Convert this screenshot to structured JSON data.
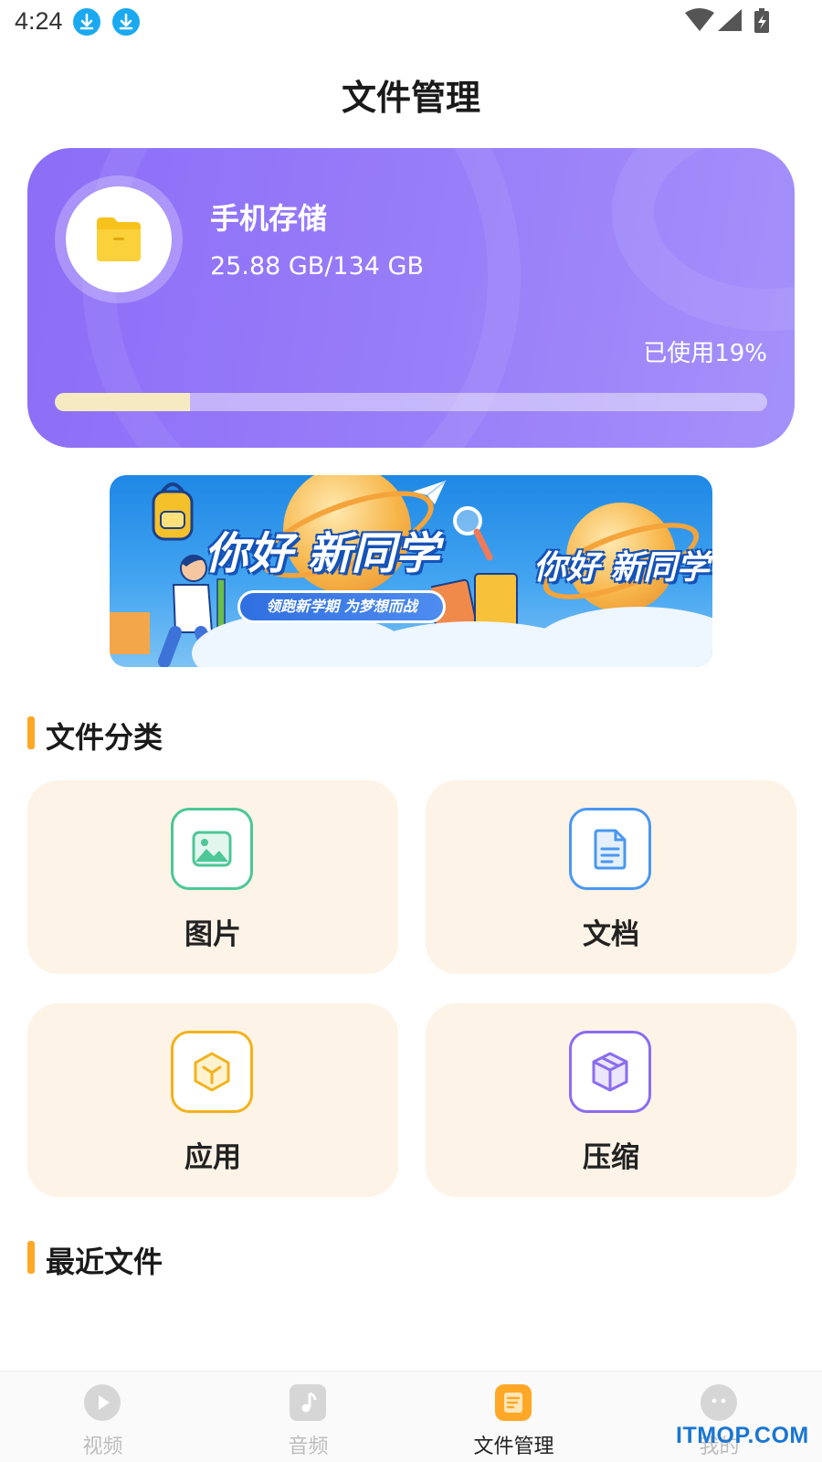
{
  "status_bar": {
    "time": "4:24"
  },
  "header": {
    "title": "文件管理"
  },
  "storage": {
    "name": "手机存储",
    "size_text": "25.88 GB/134 GB",
    "used_text": "已使用19%",
    "used_fraction": 0.19,
    "accent": "#8c6df7"
  },
  "banner": {
    "title_left": "你好 新同学",
    "subtitle": "领跑新学期 为梦想而战",
    "title_right": "你好 新同学"
  },
  "categories": {
    "heading": "文件分类",
    "items": [
      {
        "label": "图片",
        "icon": "image-icon",
        "color": "#4cc797"
      },
      {
        "label": "文档",
        "icon": "document-icon",
        "color": "#4a97f0"
      },
      {
        "label": "应用",
        "icon": "app-cube-icon",
        "color": "#f2b21c"
      },
      {
        "label": "压缩",
        "icon": "package-icon",
        "color": "#8b6cf0"
      }
    ]
  },
  "recent": {
    "heading": "最近文件"
  },
  "bottom_nav": {
    "items": [
      {
        "label": "视频",
        "icon": "play-icon"
      },
      {
        "label": "音频",
        "icon": "music-note-icon"
      },
      {
        "label": "文件管理",
        "icon": "file-manager-icon",
        "active": true
      },
      {
        "label": "我的",
        "icon": "profile-icon"
      }
    ]
  },
  "watermark": "ITMOP.COM"
}
